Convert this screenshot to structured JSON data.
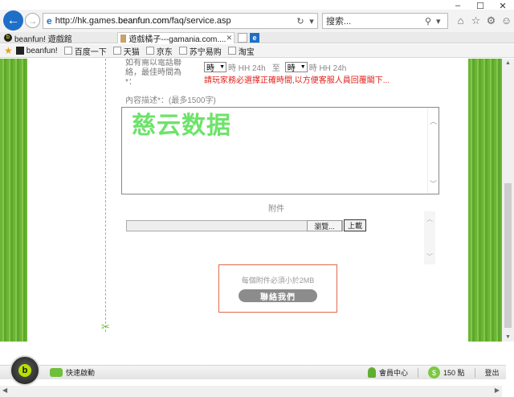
{
  "window": {
    "minimize": "–",
    "maximize": "☐",
    "close": "✕"
  },
  "address": {
    "url_prefix": "http://hk.games.",
    "url_domain": "beanfun.com",
    "url_suffix": "/faq/service.asp",
    "search_placeholder": "搜索..."
  },
  "tabs": [
    {
      "label": "beanfun! 遊戲館"
    },
    {
      "label": "遊戲橘子---gamania.com...."
    }
  ],
  "favorites": [
    "beanfun!",
    "百度一下",
    "天猫",
    "京东",
    "苏宁易购",
    "淘宝"
  ],
  "form": {
    "contact_label": "如有需以電話聯絡，最佳時間為*：",
    "hour_select_1": "時",
    "hour_unit_1": "時 HH 24h",
    "to_label": "至",
    "hour_select_2": "時",
    "hour_unit_2": "時 HH 24h",
    "warning": "請玩家務必選擇正確時間,以方便客服人員回覆閣下...",
    "description_label": "內容描述*：(最多1500字)",
    "watermark": "慈云数据",
    "attachment_label": "附件",
    "browse_button": "瀏覽...",
    "upload_button": "上載",
    "size_note": "每個附件必須小於2MB",
    "contact_button": "聯絡我們"
  },
  "beanfun_bar": {
    "quick_launch": "快速啟動",
    "member_center": "會員中心",
    "points": "150 點",
    "logout": "登出"
  },
  "colors": {
    "ie_blue": "#1e6fc8",
    "grass_green": "#6fb83a",
    "warning_red": "#e0211c",
    "watermark_green": "#5ee05a"
  }
}
